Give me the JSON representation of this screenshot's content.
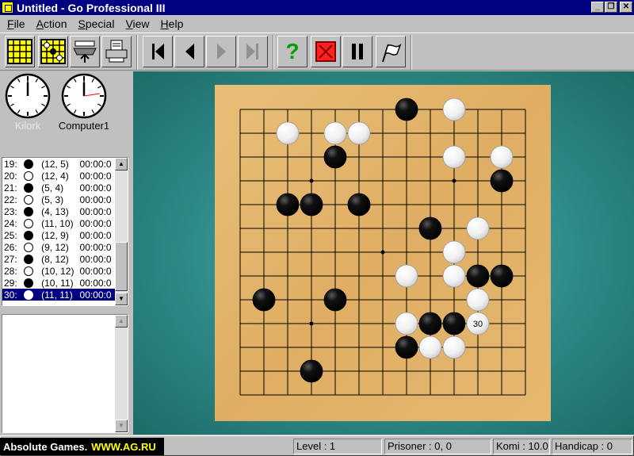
{
  "window": {
    "title": "Untitled - Go Professional III"
  },
  "menu": [
    {
      "key": "F",
      "rest": "ile"
    },
    {
      "key": "A",
      "rest": "ction"
    },
    {
      "key": "S",
      "rest": "pecial"
    },
    {
      "key": "V",
      "rest": "iew"
    },
    {
      "key": "H",
      "rest": "elp"
    }
  ],
  "toolbar": {
    "buttons": [
      "new-board-icon",
      "board-setup-icon",
      "load-game-icon",
      "print-icon",
      "first-move-icon",
      "previous-move-icon",
      "next-move-icon",
      "last-move-icon",
      "hint-icon",
      "resign-icon",
      "pause-icon",
      "pass-flag-icon"
    ]
  },
  "players": {
    "player1": {
      "name": "Kilork"
    },
    "player2": {
      "name": "Computer1"
    }
  },
  "moves": [
    {
      "n": "19:",
      "color": "black",
      "coord": "(12, 5)",
      "time": "00:00:0"
    },
    {
      "n": "20:",
      "color": "white",
      "coord": "(12, 4)",
      "time": "00:00:0"
    },
    {
      "n": "21:",
      "color": "black",
      "coord": "(5, 4)",
      "time": "00:00:0"
    },
    {
      "n": "22:",
      "color": "white",
      "coord": "(5, 3)",
      "time": "00:00:0"
    },
    {
      "n": "23:",
      "color": "black",
      "coord": "(4, 13)",
      "time": "00:00:0"
    },
    {
      "n": "24:",
      "color": "white",
      "coord": "(11, 10)",
      "time": "00:00:0"
    },
    {
      "n": "25:",
      "color": "black",
      "coord": "(12, 9)",
      "time": "00:00:0"
    },
    {
      "n": "26:",
      "color": "white",
      "coord": "(9, 12)",
      "time": "00:00:0"
    },
    {
      "n": "27:",
      "color": "black",
      "coord": "(8, 12)",
      "time": "00:00:0"
    },
    {
      "n": "28:",
      "color": "white",
      "coord": "(10, 12)",
      "time": "00:00:0"
    },
    {
      "n": "29:",
      "color": "black",
      "coord": "(10, 11)",
      "time": "00:00:0"
    },
    {
      "n": "30:",
      "color": "white",
      "coord": "(11, 11)",
      "time": "00:00:0"
    }
  ],
  "board": {
    "size": 13,
    "last_move_label": "30",
    "stones": [
      {
        "c": 7,
        "r": 0,
        "color": "black"
      },
      {
        "c": 9,
        "r": 0,
        "color": "white"
      },
      {
        "c": 2,
        "r": 1,
        "color": "white"
      },
      {
        "c": 4,
        "r": 1,
        "color": "white"
      },
      {
        "c": 5,
        "r": 1,
        "color": "white"
      },
      {
        "c": 4,
        "r": 2,
        "color": "black"
      },
      {
        "c": 9,
        "r": 2,
        "color": "white"
      },
      {
        "c": 11,
        "r": 2,
        "color": "white"
      },
      {
        "c": 11,
        "r": 3,
        "color": "black"
      },
      {
        "c": 2,
        "r": 4,
        "color": "black"
      },
      {
        "c": 3,
        "r": 4,
        "color": "black"
      },
      {
        "c": 5,
        "r": 4,
        "color": "black"
      },
      {
        "c": 8,
        "r": 5,
        "color": "black"
      },
      {
        "c": 10,
        "r": 5,
        "color": "white"
      },
      {
        "c": 9,
        "r": 6,
        "color": "white"
      },
      {
        "c": 7,
        "r": 7,
        "color": "white"
      },
      {
        "c": 9,
        "r": 7,
        "color": "white"
      },
      {
        "c": 10,
        "r": 7,
        "color": "black"
      },
      {
        "c": 11,
        "r": 7,
        "color": "black"
      },
      {
        "c": 1,
        "r": 8,
        "color": "black"
      },
      {
        "c": 4,
        "r": 8,
        "color": "black"
      },
      {
        "c": 10,
        "r": 8,
        "color": "white"
      },
      {
        "c": 7,
        "r": 9,
        "color": "white"
      },
      {
        "c": 8,
        "r": 9,
        "color": "black"
      },
      {
        "c": 9,
        "r": 9,
        "color": "black"
      },
      {
        "c": 10,
        "r": 9,
        "color": "white",
        "last": true
      },
      {
        "c": 7,
        "r": 10,
        "color": "black"
      },
      {
        "c": 8,
        "r": 10,
        "color": "white"
      },
      {
        "c": 9,
        "r": 10,
        "color": "white"
      },
      {
        "c": 3,
        "r": 11,
        "color": "black"
      }
    ]
  },
  "status": {
    "brand": "Absolute Games.",
    "brand_url": "WWW.AG.RU",
    "level": "Level : 1",
    "prisoner": "Prisoner : 0, 0",
    "komi": "Komi : 10.0",
    "handicap": "Handicap : 0"
  },
  "colors": {
    "titlebar": "#000080",
    "board_wood": "#e3b36a",
    "table": "#2e8a86"
  }
}
